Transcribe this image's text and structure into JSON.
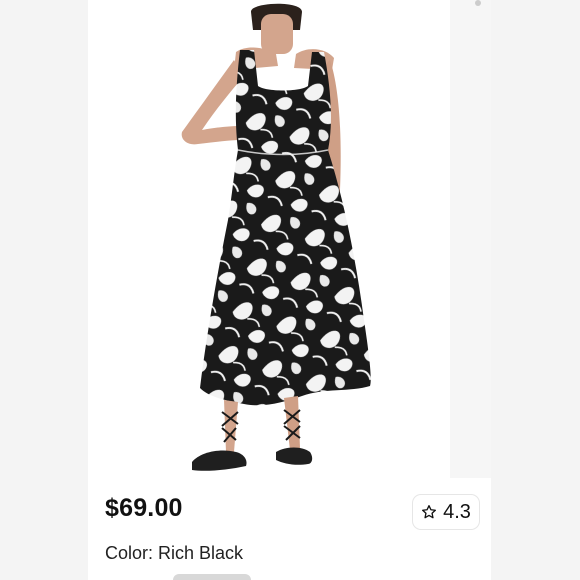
{
  "product": {
    "price": "$69.00",
    "rating": "4.3",
    "color_prefix": "Color: ",
    "color_name": "Rich Black"
  },
  "icons": {
    "rating": "star-outline-icon"
  },
  "colors": {
    "dress_primary": "#1a1a1a",
    "dress_print": "#f3f3f3",
    "page_background": "#f4f4f4"
  }
}
